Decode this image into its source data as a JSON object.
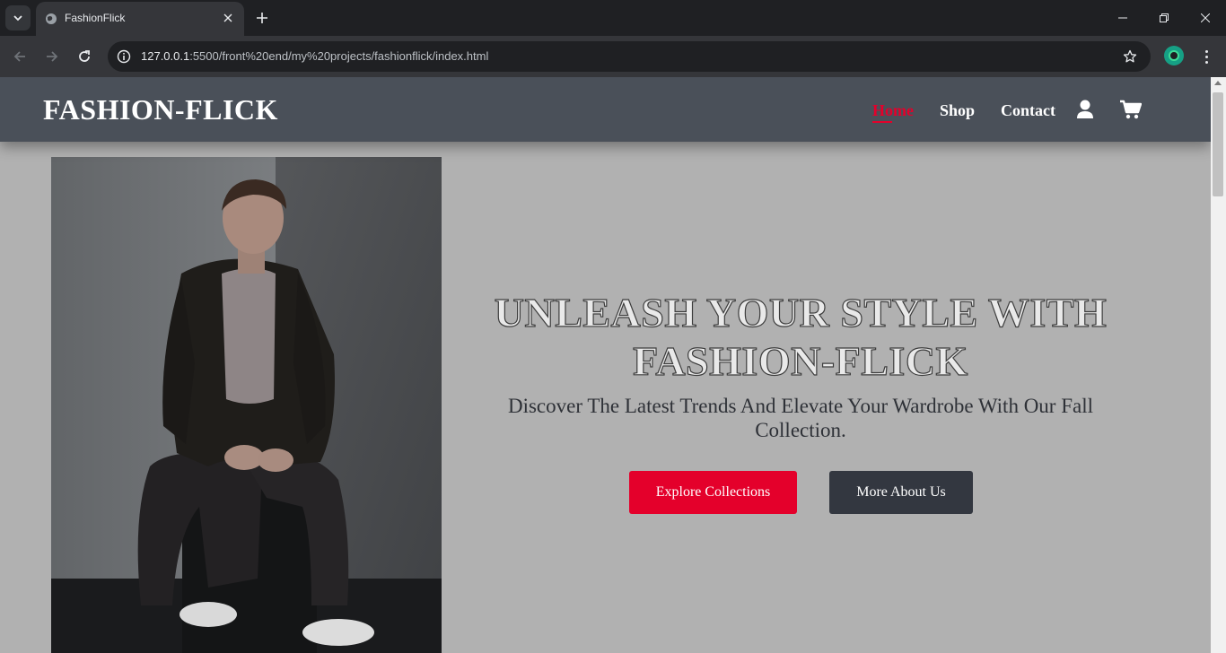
{
  "browser": {
    "tab_title": "FashionFlick",
    "url_host": "127.0.0.1",
    "url_path": ":5500/front%20end/my%20projects/fashionflick/index.html",
    "icons": [
      "tab-search-icon",
      "globe-icon",
      "close-icon",
      "plus-icon",
      "minimize-icon",
      "restore-icon",
      "close-window-icon",
      "back-arrow-icon",
      "forward-arrow-icon",
      "reload-icon",
      "site-info-icon",
      "star-icon",
      "extension-icon",
      "more-vert-icon"
    ]
  },
  "header": {
    "logo": "FASHION-FLICK",
    "nav": [
      {
        "label": "Home",
        "active": true
      },
      {
        "label": "Shop",
        "active": false
      },
      {
        "label": "Contact",
        "active": false
      }
    ],
    "icons": [
      "user-icon",
      "cart-icon"
    ]
  },
  "hero": {
    "title": "UNLEASH YOUR STYLE WITH FASHION-FLICK",
    "subtitle": "Discover The Latest Trends And Elevate Your Wardrobe With Our Fall Collection.",
    "primary_button": "Explore Collections",
    "secondary_button": "More About Us",
    "image_alt": "male model seated"
  },
  "colors": {
    "accent": "#e4002b",
    "header_bg": "#4a5059",
    "page_bg": "#b1b1b1",
    "secondary_button": "#333740"
  }
}
